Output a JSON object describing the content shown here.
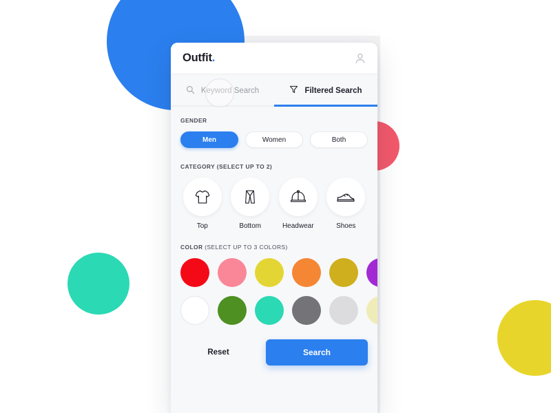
{
  "background": {
    "circles": [
      {
        "name": "blue-circle",
        "color": "#2B7FEE"
      },
      {
        "name": "teal-circle",
        "color": "#2BD9B4"
      },
      {
        "name": "pink-circle",
        "color": "#F2596B"
      },
      {
        "name": "yellow-circle",
        "color": "#E8D52B"
      }
    ]
  },
  "header": {
    "brand_name": "Outfit",
    "brand_dot": ".",
    "profile_icon": "user-icon"
  },
  "tabs": [
    {
      "label": "Keyword Search",
      "icon": "search-icon",
      "active": false
    },
    {
      "label": "Filtered Search",
      "icon": "filter-icon",
      "active": true
    }
  ],
  "gender": {
    "label": "GENDER",
    "options": [
      {
        "label": "Men",
        "selected": true
      },
      {
        "label": "Women",
        "selected": false
      },
      {
        "label": "Both",
        "selected": false
      }
    ]
  },
  "category": {
    "label": "CATEGORY (SELECT UP TO 2)",
    "items": [
      {
        "label": "Top",
        "icon": "tshirt-icon"
      },
      {
        "label": "Bottom",
        "icon": "pants-icon"
      },
      {
        "label": "Headwear",
        "icon": "cap-icon"
      },
      {
        "label": "Shoes",
        "icon": "shoe-icon"
      }
    ]
  },
  "color": {
    "label_bold": "COLOR",
    "label_rest": " (SELECT UP TO 3 COLORS)",
    "rows": [
      [
        {
          "name": "red",
          "hex": "#F40A16"
        },
        {
          "name": "pink",
          "hex": "#F98798"
        },
        {
          "name": "yellow",
          "hex": "#E3D634"
        },
        {
          "name": "orange",
          "hex": "#F58634"
        },
        {
          "name": "gold",
          "hex": "#CFAF1E"
        },
        {
          "name": "purple",
          "hex": "#A22AD4"
        }
      ],
      [
        {
          "name": "white",
          "hex": "#FFFFFF"
        },
        {
          "name": "green",
          "hex": "#4E9022"
        },
        {
          "name": "turquoise",
          "hex": "#2BD9B4"
        },
        {
          "name": "gray",
          "hex": "#737378"
        },
        {
          "name": "light-gray",
          "hex": "#DCDCDE"
        },
        {
          "name": "cream",
          "hex": "#EFECB8"
        }
      ]
    ]
  },
  "footer": {
    "reset_label": "Reset",
    "search_label": "Search"
  }
}
